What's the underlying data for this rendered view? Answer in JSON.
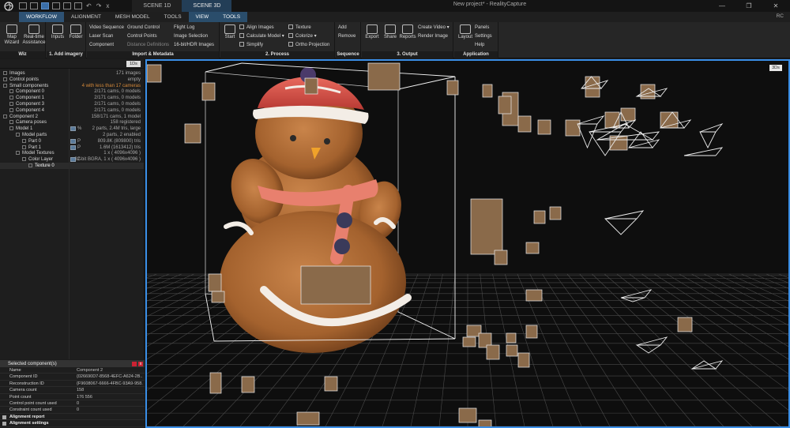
{
  "window": {
    "title": "New project* - RealityCapture",
    "scene_tabs": [
      "SCENE 1D",
      "SCENE 3D"
    ],
    "tab_close": "x",
    "minimize": "—",
    "maximize": "❐",
    "close": "✕",
    "quick_undo": "↶",
    "quick_redo": "↷"
  },
  "menu": {
    "tabs": [
      "WORKFLOW",
      "ALIGNMENT",
      "MESH MODEL",
      "TOOLS"
    ],
    "context_tabs": [
      "VIEW",
      "TOOLS"
    ],
    "right": "RC"
  },
  "ribbon": {
    "wiz": {
      "label": "Wiz",
      "buttons": [
        "Map\nWizard",
        "Real-time\nAssistance"
      ]
    },
    "add_imagery": {
      "label": "1. Add imagery",
      "buttons": [
        "Inputs",
        "Folder"
      ]
    },
    "import": {
      "label": "Import & Metadata",
      "col1": [
        "Video Sequence",
        "Laser Scan",
        "Component"
      ],
      "col2": [
        "Ground Control",
        "Control Points",
        "Distance Definitions"
      ],
      "col3": [
        "Flight Log",
        "Image Selection",
        "16-bit/HDR Images"
      ]
    },
    "process": {
      "label": "2. Process",
      "start": "Start",
      "col1": [
        "Align Images",
        "Calculate Model ▾",
        "Simplify"
      ],
      "col2": [
        "Texture",
        "Colorize ▾",
        "Ortho Projection"
      ]
    },
    "sequence": {
      "label": "Sequence",
      "buttons": [
        "Add",
        "Remove"
      ]
    },
    "output": {
      "label": "3. Output",
      "buttons": [
        "Export",
        "Share",
        "Reports"
      ],
      "col": [
        "Create Video ▾",
        "Render Image"
      ]
    },
    "application": {
      "label": "Application",
      "layout": "Layout",
      "col": [
        "Panels",
        "Settings",
        "Help"
      ]
    }
  },
  "tree": {
    "toggle_1d": "1Ds",
    "rows": [
      {
        "label": "Images",
        "value": "171 images",
        "indent": 0
      },
      {
        "label": "Control points",
        "value": "empty",
        "indent": 0
      },
      {
        "label": "Small components",
        "value": "4 with less than 17 cameras",
        "indent": 0,
        "warn": true
      },
      {
        "label": "Component 0",
        "value": "2/171 cams, 0 models",
        "indent": 1
      },
      {
        "label": "Component 1",
        "value": "2/171 cams, 0 models",
        "indent": 1
      },
      {
        "label": "Component 3",
        "value": "2/171 cams, 0 models",
        "indent": 1
      },
      {
        "label": "Component 4",
        "value": "2/171 cams, 0 models",
        "indent": 1
      },
      {
        "label": "Component 2",
        "value": "158/171 cams, 1 model",
        "indent": 0
      },
      {
        "label": "Camera poses",
        "value": "158 registered",
        "indent": 1
      },
      {
        "label": "Model 1",
        "value": "2 parts, 2.4M tris, large",
        "indent": 1,
        "mini": "%"
      },
      {
        "label": "Model parts",
        "value": "2 parts, 2 enabled",
        "indent": 2
      },
      {
        "label": "Part 0",
        "value": "809.8K (809800) tris",
        "indent": 3,
        "mini": "P"
      },
      {
        "label": "Part 1",
        "value": "1.6M (1613412) tris",
        "indent": 3,
        "mini": "P"
      },
      {
        "label": "Model Textures",
        "value": "1 x ( 4096x4096 )",
        "indent": 2
      },
      {
        "label": "Color Layer",
        "value": "32-bit BGRA, 1 x ( 4096x4096 )",
        "indent": 3,
        "mini": "C"
      },
      {
        "label": "Texture 0",
        "value": "",
        "indent": 4,
        "selected": true
      }
    ]
  },
  "props": {
    "title": "Selected component(s)",
    "close": "x",
    "rows": [
      {
        "key": "Name",
        "value": "Component 2"
      },
      {
        "key": "Component ID",
        "value": "{026690D7-8568-4EFC-A624-2B..."
      },
      {
        "key": "Reconstruction ID",
        "value": "{F9608067-6666-4FBC-93A9-958..."
      },
      {
        "key": "Camera count",
        "value": "158"
      },
      {
        "key": "Point count",
        "value": "176 556"
      },
      {
        "key": "Control point count used",
        "value": "0"
      },
      {
        "key": "Constraint count used",
        "value": "0"
      }
    ],
    "sections": [
      "Alignment report",
      "Alignment settings"
    ]
  },
  "viewport": {
    "badge": "3Ds"
  },
  "colors": {
    "accent": "#3a8ee6",
    "active_tab": "#2e5274",
    "warning": "#d68a3a",
    "cookie": "#b8703a",
    "icing": "#f3ede6",
    "hat": "#d8504a",
    "scarf": "#e8806e"
  }
}
